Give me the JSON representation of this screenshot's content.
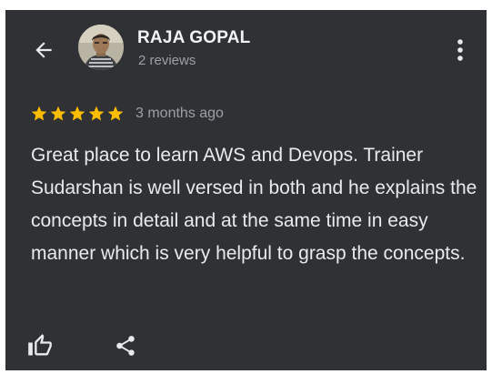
{
  "reviewer": {
    "name": "RAJA GOPAL",
    "reviews_count": "2 reviews"
  },
  "review": {
    "rating": 5,
    "max_rating": 5,
    "time_ago": "3 months ago",
    "text": "Great place to learn AWS and Devops. Trainer Sudarshan is well versed in both and he explains the concepts in detail and at the same time in easy manner which is very helpful to grasp the concepts."
  },
  "icons": {
    "back": "arrow-back-icon",
    "more": "more-vert-icon",
    "star": "star-icon",
    "like": "thumbs-up-icon",
    "share": "share-icon"
  },
  "colors": {
    "background": "#303134",
    "primary_text": "#e8eaed",
    "secondary_text": "#9aa0a6",
    "star": "#fbbc04"
  }
}
